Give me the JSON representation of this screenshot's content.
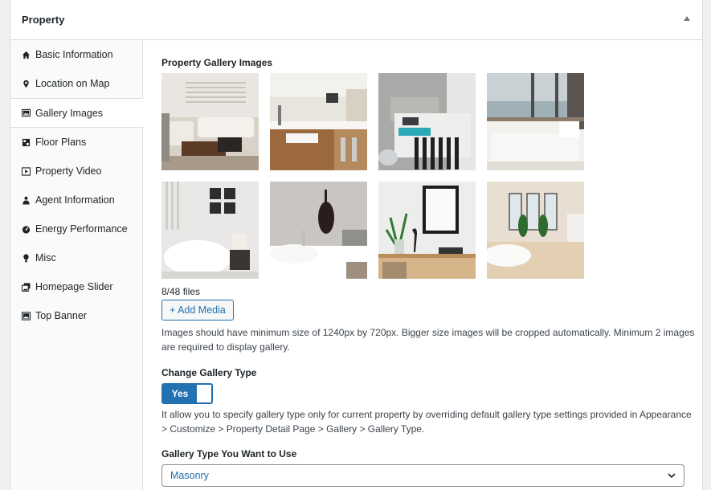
{
  "panel": {
    "title": "Property"
  },
  "sidebar": {
    "items": [
      {
        "label": "Basic Information",
        "icon": "home-icon"
      },
      {
        "label": "Location on Map",
        "icon": "location-pin-icon"
      },
      {
        "label": "Gallery Images",
        "icon": "gallery-icon",
        "active": true
      },
      {
        "label": "Floor Plans",
        "icon": "floor-plan-icon"
      },
      {
        "label": "Property Video",
        "icon": "video-icon"
      },
      {
        "label": "Agent Information",
        "icon": "agent-icon"
      },
      {
        "label": "Energy Performance",
        "icon": "energy-gauge-icon"
      },
      {
        "label": "Misc",
        "icon": "lightbulb-icon"
      },
      {
        "label": "Homepage Slider",
        "icon": "slider-images-icon"
      },
      {
        "label": "Top Banner",
        "icon": "banner-image-icon"
      }
    ]
  },
  "gallery": {
    "label": "Property Gallery Images",
    "images": [
      "living-room-photo",
      "kitchen-photo",
      "bedroom-photo",
      "bedroom-seaview-photo",
      "bathtub-photo",
      "bathroom-sink-photo",
      "shelf-decor-photo",
      "bathroom-photo"
    ],
    "files_count": "8/48 files",
    "add_button": "+ Add Media",
    "help": "Images should have minimum size of 1240px by 720px. Bigger size images will be cropped automatically. Minimum 2 images are required to display gallery."
  },
  "gallery_type_toggle": {
    "label": "Change Gallery Type",
    "value": "Yes",
    "help": "It allow you to specify gallery type only for current property by overriding default gallery type settings provided in Appearance > Customize > Property Detail Page > Gallery > Gallery Type."
  },
  "gallery_type_select": {
    "label": "Gallery Type You Want to Use",
    "value": "Masonry"
  },
  "colors": {
    "accent": "#2271b1",
    "border": "#dcdcde",
    "text": "#1d2327"
  }
}
